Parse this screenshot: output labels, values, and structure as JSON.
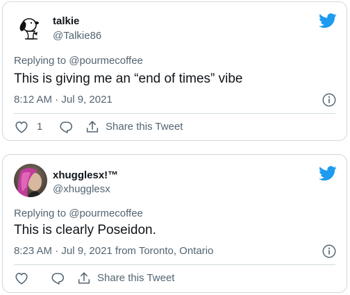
{
  "tweets": [
    {
      "author_name": "talkie",
      "author_handle": "@Talkie86",
      "replying_to": "Replying to @pourmecoffee",
      "text": "This is giving me an “end of times” vibe",
      "meta": "8:12 AM · Jul 9, 2021",
      "like_count": "1",
      "share_label": "Share this Tweet",
      "avatar": "snoopy-avatar"
    },
    {
      "author_name": "xhugglesx!™",
      "author_handle": "@xhugglesx",
      "replying_to": "Replying to @pourmecoffee",
      "text": "This is clearly Poseidon.",
      "meta": "8:23 AM · Jul 9, 2021 from Toronto, Ontario",
      "like_count": "",
      "share_label": "Share this Tweet",
      "avatar": "purple-pink-hair-avatar"
    }
  ],
  "colors": {
    "brand": "#1d9bf0",
    "text": "#0f1419",
    "secondary": "#536471",
    "border": "#cfd9de"
  },
  "icons": [
    "twitter-bird-icon",
    "info-icon",
    "heart-icon",
    "reply-icon",
    "share-icon"
  ]
}
